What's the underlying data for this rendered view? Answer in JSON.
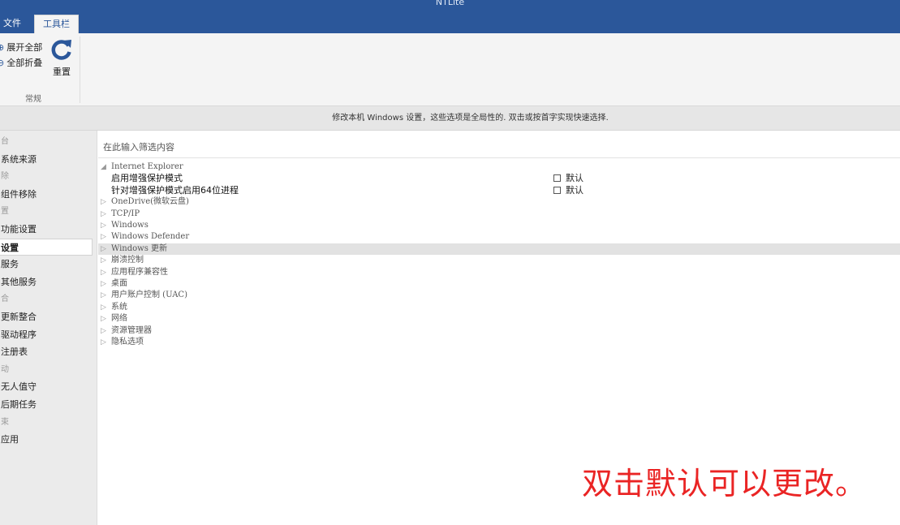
{
  "app": {
    "title": "NTLite"
  },
  "tabs": {
    "file": "文件",
    "toolbar": "工具栏"
  },
  "ribbon": {
    "expand_all": "展开全部",
    "collapse_all": "全部折叠",
    "reset": "重置",
    "group_label": "常规",
    "accent": "#2b579a"
  },
  "info_message": "修改本机 Windows 设置，这些选项是全局性的. 双击或按首字实现快速选择.",
  "sidebar": {
    "items": [
      {
        "label": "台",
        "type": "header"
      },
      {
        "label": "系统来源",
        "type": "item"
      },
      {
        "label": "除",
        "type": "header"
      },
      {
        "label": "组件移除",
        "type": "item"
      },
      {
        "label": "置",
        "type": "header"
      },
      {
        "label": "功能设置",
        "type": "item"
      },
      {
        "label": "设置",
        "type": "item",
        "selected": true
      },
      {
        "label": "服务",
        "type": "item"
      },
      {
        "label": "其他服务",
        "type": "item"
      },
      {
        "label": "合",
        "type": "header"
      },
      {
        "label": "更新整合",
        "type": "item"
      },
      {
        "label": "驱动程序",
        "type": "item"
      },
      {
        "label": "注册表",
        "type": "item"
      },
      {
        "label": "动",
        "type": "header"
      },
      {
        "label": "无人值守",
        "type": "item"
      },
      {
        "label": "后期任务",
        "type": "item"
      },
      {
        "label": "束",
        "type": "header"
      },
      {
        "label": "应用",
        "type": "item"
      }
    ]
  },
  "filter": {
    "placeholder": "在此输入筛选内容"
  },
  "tree": {
    "expanded_glyph": "◢",
    "collapsed_glyph": "▷",
    "expanded": {
      "label": "Internet Explorer"
    },
    "children": [
      {
        "label": "启用增强保护模式",
        "value": "默认"
      },
      {
        "label": "针对增强保护模式启用64位进程",
        "value": "默认"
      }
    ],
    "groups": [
      "OneDrive(微软云盘)",
      "TCP/IP",
      "Windows",
      "Windows Defender",
      "Windows 更新",
      "崩溃控制",
      "应用程序兼容性",
      "桌面",
      "用户账户控制 (UAC)",
      "系统",
      "网络",
      "资源管理器",
      "隐私选项"
    ],
    "highlighted_index": 4
  },
  "annotation": {
    "text": "双击默认可以更改。",
    "color": "#ea2424"
  }
}
